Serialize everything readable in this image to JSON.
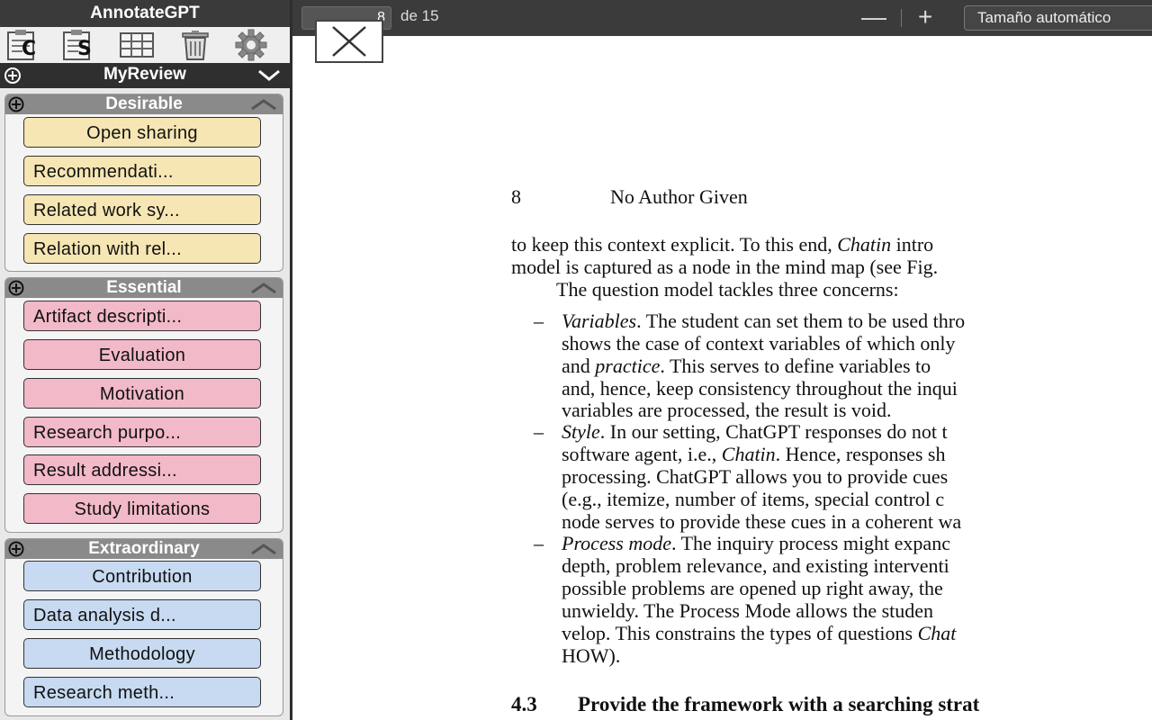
{
  "sidebar": {
    "app_title": "AnnotateGPT",
    "toolbar": {
      "tool1_letter": "C",
      "tool2_letter": "S"
    },
    "review_name": "MyReview",
    "groups": [
      {
        "name": "Desirable",
        "color": "#f6e6b4",
        "codes": [
          "Open sharing",
          "Recommendati...",
          "Related work sy...",
          "Relation with rel..."
        ]
      },
      {
        "name": "Essential",
        "color": "#f2b9c8",
        "codes": [
          "Artifact descripti...",
          "Evaluation",
          "Motivation",
          "Research purpo...",
          "Result addressi...",
          "Study limitations"
        ]
      },
      {
        "name": "Extraordinary",
        "color": "#c7daf1",
        "codes": [
          "Contribution",
          "Data analysis d...",
          "Methodology",
          "Research meth..."
        ]
      }
    ]
  },
  "viewer": {
    "page_number": "8",
    "page_of": "de 15",
    "zoom_out": "—",
    "zoom_in": "+",
    "zoom_label": "Tamaño automático"
  },
  "pdf": {
    "page_num": "8",
    "running_head": "No Author Given",
    "lines": {
      "l1a": "to keep this context explicit. To this end, ",
      "l1b": "Chatin",
      "l1c": " intro",
      "l2": "model is captured as a node in the mind map (see Fig.",
      "l3": "The question model tackles three concerns:",
      "b1_1a": "Variables",
      "b1_1b": ". The student can set them to be used thro",
      "b1_2": "shows the case of context variables of which only",
      "b1_3a": "and ",
      "b1_3b": "practice",
      "b1_3c": ". This serves to define variables to",
      "b1_4": "and, hence, keep consistency throughout the inqui",
      "b1_5": "variables are processed, the result is void.",
      "b2_1a": "Style",
      "b2_1b": ". In our setting, ChatGPT responses do not t",
      "b2_2a": "software agent, i.e., ",
      "b2_2b": "Chatin",
      "b2_2c": ". Hence, responses sh",
      "b2_3": "processing. ChatGPT allows you to provide cues",
      "b2_4": "(e.g., itemize, number of items, special control c",
      "b2_5": "node serves to provide these cues in a coherent wa",
      "b3_1a": "Process mode",
      "b3_1b": ". The inquiry process might expanc",
      "b3_2": "depth, problem relevance, and existing interventi",
      "b3_3": "possible problems are opened up right away, the",
      "b3_4": "unwieldy. The Process Mode allows the studen",
      "b3_5a": "velop. This constrains the types of questions ",
      "b3_5b": "Chat",
      "b3_6": "HOW).",
      "heading_num": "4.3",
      "heading_text": "Provide the framework with a searching strat"
    },
    "bullet": "–"
  }
}
